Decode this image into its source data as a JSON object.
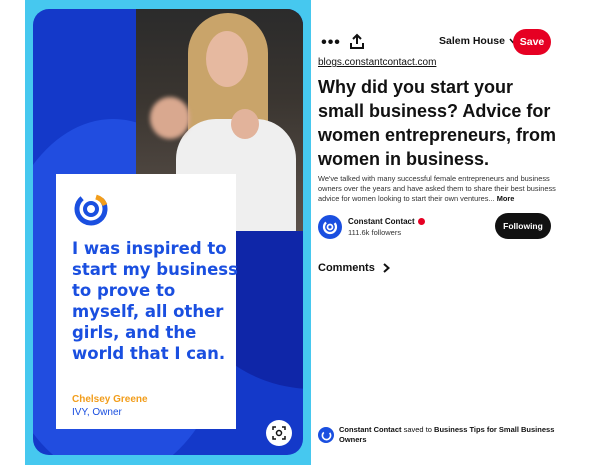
{
  "pin": {
    "quote": "I was inspired to start my business to prove to myself, all other girls, and the world that I can.",
    "quote_name": "Chelsey Greene",
    "quote_role": "IVY, Owner",
    "accent_blue": "#1a4fe0",
    "accent_orange": "#f29d1b",
    "lens_icon": "visual-search-icon"
  },
  "toolbar": {
    "more_icon": "•••",
    "share_icon": "share-icon",
    "board": "Salem House",
    "save_label": "Save"
  },
  "details": {
    "source": "blogs.constantcontact.com",
    "title": "Why did you start your small business? Advice for women entrepreneurs, from women in business.",
    "description": "We've talked with many successful female entrepreneurs and business owners over the years and have asked them to share their best business advice for women looking to start their own ventures...",
    "more_label": "More"
  },
  "author": {
    "name": "Constant Contact",
    "followers": "111.6k followers",
    "follow_label": "Following"
  },
  "comments": {
    "label": "Comments"
  },
  "saved": {
    "by": "Constant Contact",
    "action": "saved to",
    "board": "Business Tips for Small Business Owners"
  },
  "colors": {
    "save": "#e60023",
    "frame": "#46c8ef"
  }
}
